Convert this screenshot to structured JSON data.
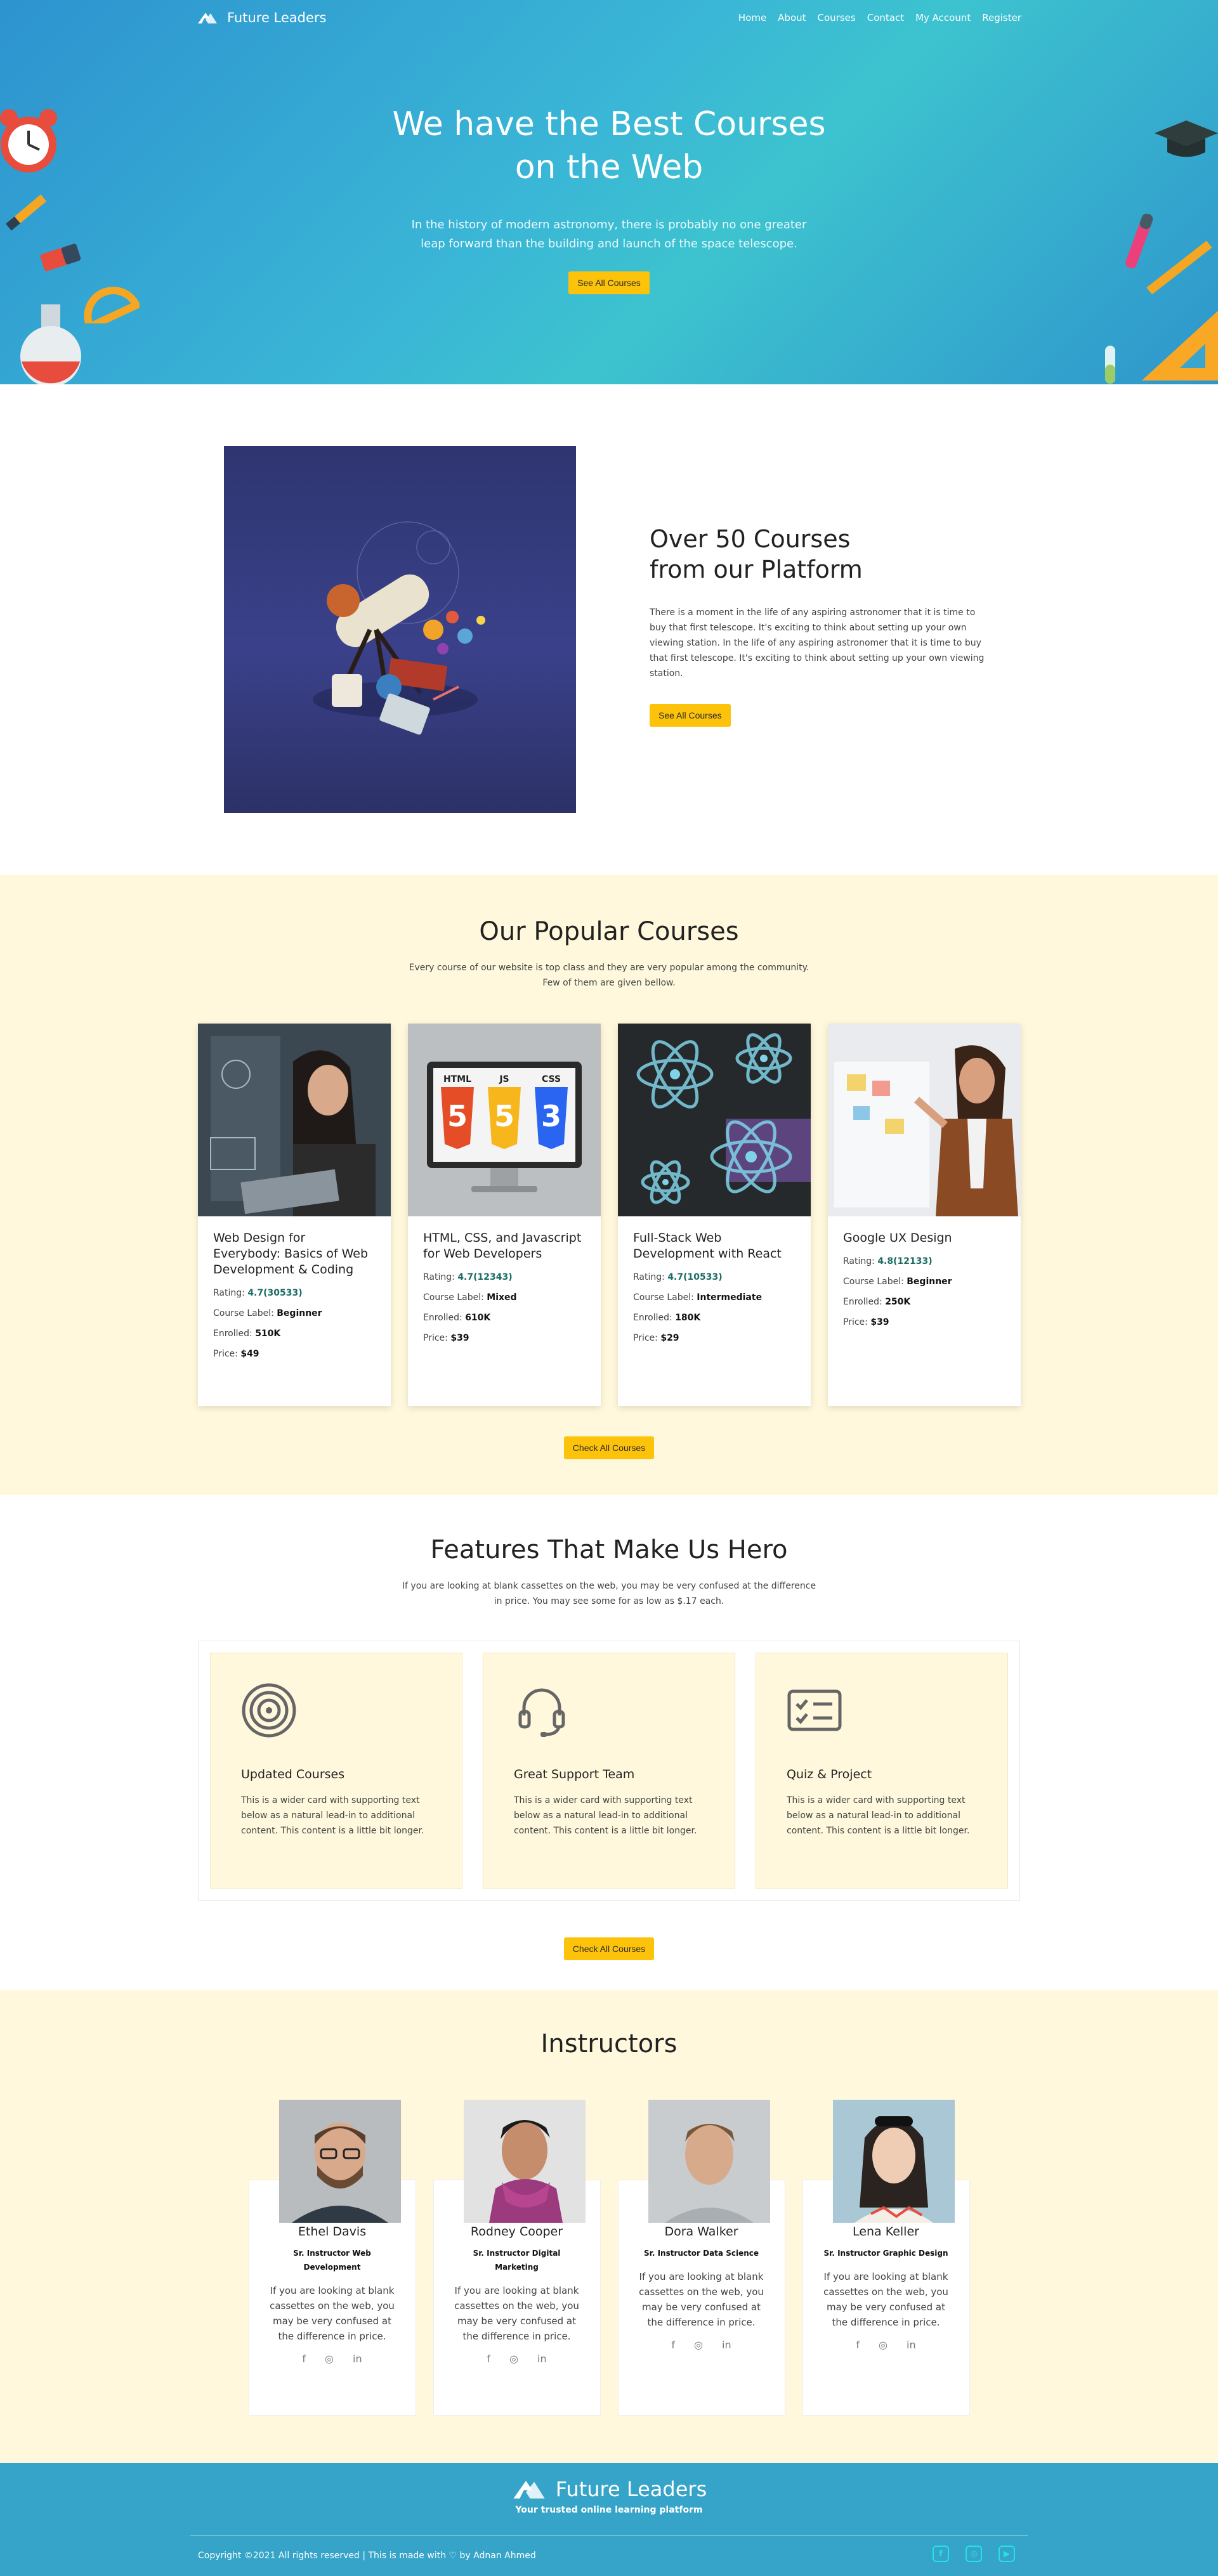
{
  "nav": {
    "brand": "Future Leaders",
    "items": [
      "Home",
      "About",
      "Courses",
      "Contact",
      "My Account",
      "Register"
    ]
  },
  "hero": {
    "title_line1": "We have the Best Courses",
    "title_line2": "on the Web",
    "text": "In the history of modern astronomy, there is probably no one greater leap forward than the building and launch of the space telescope.",
    "button": "See All Courses"
  },
  "about": {
    "title_line1": "Over 50 Courses",
    "title_line2": "from our Platform",
    "text": "There is a moment in the life of any aspiring astronomer that it is time to buy that first telescope. It's exciting to think about setting up your own viewing station. In the life of any aspiring astronomer that it is time to buy that first telescope. It's exciting to think about setting up your own viewing station.",
    "button": "See All Courses"
  },
  "popular": {
    "title": "Our Popular Courses",
    "subtitle": "Every course of our website is top class and they are very popular among the community. Few of them are given bellow.",
    "labels": {
      "rating": "Rating: ",
      "level": "Course Label: ",
      "enrolled": "Enrolled: ",
      "price": "Price: "
    },
    "courses": [
      {
        "title": "Web Design for Everybody: Basics of Web Development & Coding",
        "rating": "4.7(30533)",
        "level": "Beginner",
        "enrolled": "510K",
        "price": "$49"
      },
      {
        "title": "HTML, CSS, and Javascript for Web Developers",
        "rating": "4.7(12343)",
        "level": "Mixed",
        "enrolled": "610K",
        "price": "$39"
      },
      {
        "title": "Full-Stack Web Development with React",
        "rating": "4.7(10533)",
        "level": "Intermediate",
        "enrolled": "180K",
        "price": "$29"
      },
      {
        "title": "Google UX Design",
        "rating": "4.8(12133)",
        "level": "Beginner",
        "enrolled": "250K",
        "price": "$39"
      }
    ],
    "html_badges": [
      "HTML",
      "JS",
      "CSS"
    ],
    "button": "Check All Courses"
  },
  "features": {
    "title": "Features That Make Us Hero",
    "subtitle": "If you are looking at blank cassettes on the web, you may be very confused at the difference in price. You may see some for as low as $.17 each.",
    "items": [
      {
        "icon": "target-icon",
        "title": "Updated Courses",
        "text": "This is a wider card with supporting text below as a natural lead-in to additional content. This content is a little bit longer."
      },
      {
        "icon": "headset-icon",
        "title": "Great Support Team",
        "text": "This is a wider card with supporting text below as a natural lead-in to additional content. This content is a little bit longer."
      },
      {
        "icon": "checklist-icon",
        "title": "Quiz & Project",
        "text": "This is a wider card with supporting text below as a natural lead-in to additional content. This content is a little bit longer."
      }
    ],
    "button": "Check All Courses"
  },
  "instructors": {
    "title": "Instructors",
    "people": [
      {
        "name": "Ethel Davis",
        "role": "Sr. Instructor Web Development",
        "bio": "If you are looking at blank cassettes on the web, you may be very confused at the difference in price."
      },
      {
        "name": "Rodney Cooper",
        "role": "Sr. Instructor Digital Marketing",
        "bio": "If you are looking at blank cassettes on the web, you may be very confused at the difference in price."
      },
      {
        "name": "Dora Walker",
        "role": "Sr. Instructor Data Science",
        "bio": "If you are looking at blank cassettes on the web, you may be very confused at the difference in price."
      },
      {
        "name": "Lena Keller",
        "role": "Sr. Instructor Graphic Design",
        "bio": "If you are looking at blank cassettes on the web, you may be very confused at the difference in price."
      }
    ]
  },
  "footer": {
    "brand": "Future Leaders",
    "tagline": "Your trusted online learning platform",
    "copyright": "Copyright ©2021 All rights reserved | This is made with ♡ by Adnan Ahmed",
    "social_icons": [
      "facebook-icon",
      "instagram-icon",
      "youtube-icon"
    ]
  },
  "colors": {
    "primary": "#35a4c8",
    "accent": "#fcc30a",
    "cream": "#fff8dc",
    "rating": "#1a6b62"
  }
}
